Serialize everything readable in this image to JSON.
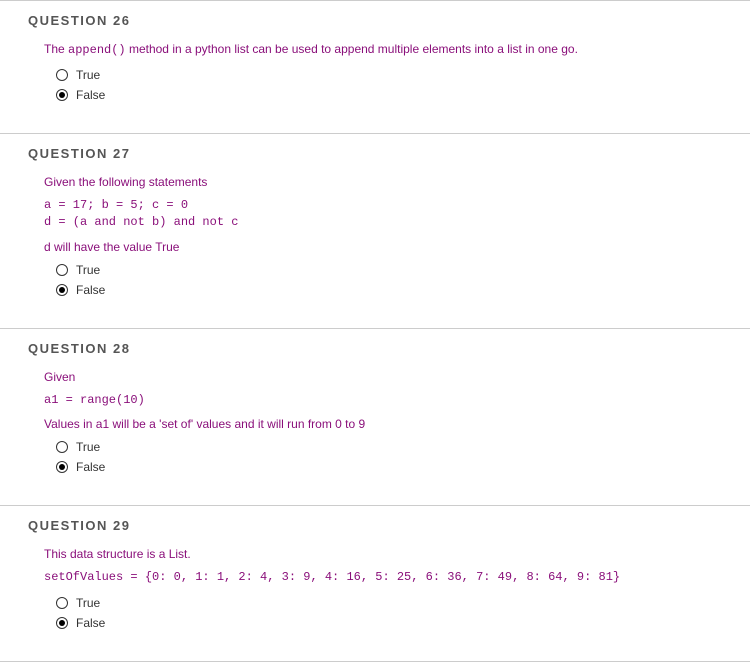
{
  "questions": [
    {
      "header": "QUESTION 26",
      "prompt_parts": [
        {
          "text": "The ",
          "code": false
        },
        {
          "text": "append()",
          "code": true
        },
        {
          "text": " method in a python list can be used to append multiple elements into a list in one go.",
          "code": false
        }
      ],
      "code_block": "",
      "followup": "",
      "options": [
        {
          "label": "True",
          "selected": false
        },
        {
          "label": "False",
          "selected": true
        }
      ]
    },
    {
      "header": "QUESTION 27",
      "prompt_parts": [
        {
          "text": "Given the following statements",
          "code": false
        }
      ],
      "code_block": "a = 17; b = 5; c = 0\nd = (a and not b) and not c",
      "followup_parts": [
        {
          "text": "d will have the value ",
          "code": false
        },
        {
          "text": "True",
          "code": true
        }
      ],
      "options": [
        {
          "label": "True",
          "selected": false
        },
        {
          "label": "False",
          "selected": true
        }
      ]
    },
    {
      "header": "QUESTION 28",
      "prompt_parts": [
        {
          "text": "Given",
          "code": false
        }
      ],
      "code_block": "a1 = range(10)",
      "followup_parts": [
        {
          "text": "Values in a1 will be a 'set of' values and it will run from 0 to 9",
          "code": false
        }
      ],
      "options": [
        {
          "label": "True",
          "selected": false
        },
        {
          "label": "False",
          "selected": true
        }
      ]
    },
    {
      "header": "QUESTION 29",
      "prompt_parts": [
        {
          "text": "This data structure is a List.",
          "code": false
        }
      ],
      "code_block": "setOfValues = {0: 0, 1: 1, 2: 4, 3: 9, 4: 16, 5: 25, 6: 36, 7: 49, 8: 64, 9: 81}",
      "followup_parts": [],
      "options": [
        {
          "label": "True",
          "selected": false
        },
        {
          "label": "False",
          "selected": true
        }
      ]
    }
  ]
}
